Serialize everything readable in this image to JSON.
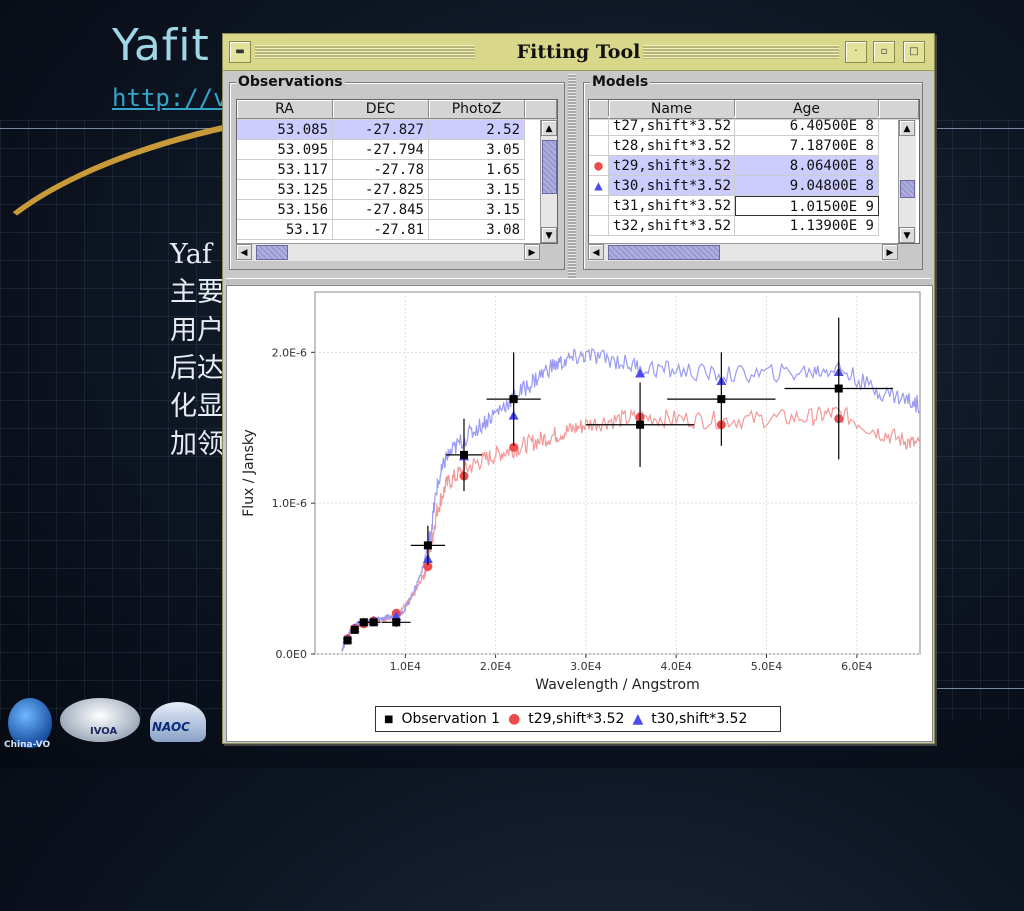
{
  "slide": {
    "title": "Yafit",
    "link": "http://v",
    "body_lines": [
      "Yaf",
      "主要",
      "用户",
      "后达",
      "化显",
      "加领"
    ],
    "logos": {
      "chinavo": "China-VO",
      "ivoa": "IVOA",
      "naoc": "NAOC"
    }
  },
  "window": {
    "title": "Fitting Tool",
    "buttons": [
      "minimize",
      "maximize",
      "close"
    ]
  },
  "observations": {
    "title": "Observations",
    "columns": [
      "RA",
      "DEC",
      "PhotoZ"
    ],
    "rows": [
      {
        "ra": "53.085",
        "dec": "-27.827",
        "z": "2.52",
        "selected": true
      },
      {
        "ra": "53.095",
        "dec": "-27.794",
        "z": "3.05",
        "selected": false
      },
      {
        "ra": "53.117",
        "dec": "-27.78",
        "z": "1.65",
        "selected": false
      },
      {
        "ra": "53.125",
        "dec": "-27.825",
        "z": "3.15",
        "selected": false
      },
      {
        "ra": "53.156",
        "dec": "-27.845",
        "z": "3.15",
        "selected": false
      },
      {
        "ra": "53.17",
        "dec": "-27.81",
        "z": "3.08",
        "selected": false
      }
    ]
  },
  "models": {
    "title": "Models",
    "columns": [
      "Name",
      "Age"
    ],
    "rows": [
      {
        "name": "t27,shift*3.52",
        "age": "6.40500E 8",
        "marker": "",
        "selected": false
      },
      {
        "name": "t28,shift*3.52",
        "age": "7.18700E 8",
        "marker": "",
        "selected": false
      },
      {
        "name": "t29,shift*3.52",
        "age": "8.06400E 8",
        "marker": "circle",
        "selected": true
      },
      {
        "name": "t30,shift*3.52",
        "age": "9.04800E 8",
        "marker": "triangle",
        "selected": true
      },
      {
        "name": "t31,shift*3.52",
        "age": "1.01500E 9",
        "marker": "",
        "selected": false
      },
      {
        "name": "t32,shift*3.52",
        "age": "1.13900E 9",
        "marker": "",
        "selected": false
      }
    ]
  },
  "chart_data": {
    "type": "scatter",
    "xlabel": "Wavelength / Angstrom",
    "ylabel": "Flux / Jansky",
    "xlim": [
      0,
      67000
    ],
    "ylim": [
      0,
      2.4e-06
    ],
    "x_ticks": [
      "1.0E4",
      "2.0E4",
      "3.0E4",
      "4.0E4",
      "5.0E4",
      "6.0E4"
    ],
    "y_ticks": [
      "0.0E0",
      "1.0E-6",
      "2.0E-6"
    ],
    "grid": true,
    "legend_position": "bottom",
    "series": [
      {
        "name": "Observation 1",
        "marker": "square",
        "color": "#000000",
        "points": [
          {
            "x": 3600,
            "y": 9e-08,
            "xerr": 0,
            "yerr": 2e-08
          },
          {
            "x": 4400,
            "y": 1.6e-07,
            "xerr": 400,
            "yerr": 2e-08
          },
          {
            "x": 5400,
            "y": 2.1e-07,
            "xerr": 600,
            "yerr": 2e-08
          },
          {
            "x": 6500,
            "y": 2.1e-07,
            "xerr": 700,
            "yerr": 2e-08
          },
          {
            "x": 9000,
            "y": 2.1e-07,
            "xerr": 1600,
            "yerr": 3e-08
          },
          {
            "x": 12500,
            "y": 7.2e-07,
            "xerr": 1900,
            "yerr": 1.3e-07
          },
          {
            "x": 16500,
            "y": 1.32e-06,
            "xerr": 2000,
            "yerr": 2.4e-07
          },
          {
            "x": 22000,
            "y": 1.69e-06,
            "xerr": 3000,
            "yerr": 3.1e-07
          },
          {
            "x": 36000,
            "y": 1.52e-06,
            "xerr": 6000,
            "yerr": 2.8e-07
          },
          {
            "x": 45000,
            "y": 1.69e-06,
            "xerr": 6000,
            "yerr": 3.1e-07
          },
          {
            "x": 58000,
            "y": 1.76e-06,
            "xerr": 6000,
            "yerr": 4.7e-07
          }
        ]
      },
      {
        "name": "t29,shift*3.52",
        "marker": "circle",
        "color": "#ee4b4b",
        "points": [
          {
            "x": 3600,
            "y": 1e-07
          },
          {
            "x": 4400,
            "y": 1.7e-07
          },
          {
            "x": 5400,
            "y": 2e-07
          },
          {
            "x": 6500,
            "y": 2.2e-07
          },
          {
            "x": 9000,
            "y": 2.7e-07
          },
          {
            "x": 12500,
            "y": 5.8e-07
          },
          {
            "x": 16500,
            "y": 1.18e-06
          },
          {
            "x": 22000,
            "y": 1.37e-06
          },
          {
            "x": 36000,
            "y": 1.57e-06
          },
          {
            "x": 45000,
            "y": 1.52e-06
          },
          {
            "x": 58000,
            "y": 1.56e-06
          }
        ]
      },
      {
        "name": "t30,shift*3.52",
        "marker": "triangle",
        "color": "#4b4bee",
        "points": [
          {
            "x": 3600,
            "y": 1e-07
          },
          {
            "x": 4400,
            "y": 1.7e-07
          },
          {
            "x": 5400,
            "y": 2.1e-07
          },
          {
            "x": 6500,
            "y": 2.2e-07
          },
          {
            "x": 9000,
            "y": 2.5e-07
          },
          {
            "x": 12500,
            "y": 6.3e-07
          },
          {
            "x": 16500,
            "y": 1.31e-06
          },
          {
            "x": 22000,
            "y": 1.58e-06
          },
          {
            "x": 36000,
            "y": 1.86e-06
          },
          {
            "x": 45000,
            "y": 1.81e-06
          },
          {
            "x": 58000,
            "y": 1.87e-06
          }
        ]
      }
    ],
    "spectra": [
      {
        "name": "t29,shift*3.52",
        "color": "#f29a9a",
        "x": [
          3000,
          3500,
          4000,
          4500,
          5000,
          6000,
          7000,
          8000,
          9000,
          10000,
          11000,
          12000,
          12800,
          13500,
          14500,
          16000,
          18000,
          20000,
          22000,
          24000,
          26000,
          28000,
          30000,
          33000,
          36000,
          40000,
          45000,
          50000,
          55000,
          58000,
          62000,
          65000,
          67000
        ],
        "y": [
          3e-08,
          1e-07,
          1.6e-07,
          1.9e-07,
          2e-07,
          2.1e-07,
          2.2e-07,
          2.4e-07,
          2.7e-07,
          3.2e-07,
          4e-07,
          5.2e-07,
          7e-07,
          9.5e-07,
          1.12e-06,
          1.2e-06,
          1.27e-06,
          1.32e-06,
          1.36e-06,
          1.4e-06,
          1.44e-06,
          1.48e-06,
          1.52e-06,
          1.55e-06,
          1.57e-06,
          1.56e-06,
          1.55e-06,
          1.56e-06,
          1.57e-06,
          1.6e-06,
          1.48e-06,
          1.42e-06,
          1.38e-06
        ]
      },
      {
        "name": "t30,shift*3.52",
        "color": "#9a9af2",
        "x": [
          3000,
          3500,
          4000,
          4500,
          5000,
          6000,
          7000,
          8000,
          9000,
          10000,
          11000,
          12000,
          12800,
          13500,
          14500,
          16000,
          18000,
          20000,
          22000,
          24000,
          26000,
          28000,
          30000,
          33000,
          36000,
          40000,
          45000,
          50000,
          55000,
          58000,
          62000,
          65000,
          67000
        ],
        "y": [
          3e-08,
          1e-07,
          1.6e-07,
          1.9e-07,
          2.1e-07,
          2.2e-07,
          2.3e-07,
          2.4e-07,
          2.5e-07,
          3e-07,
          4.2e-07,
          5.8e-07,
          8e-07,
          1.1e-06,
          1.3e-06,
          1.4e-06,
          1.5e-06,
          1.6e-06,
          1.7e-06,
          1.8e-06,
          1.9e-06,
          1.95e-06,
          1.98e-06,
          1.95e-06,
          1.9e-06,
          1.88e-06,
          1.85e-06,
          1.86e-06,
          1.87e-06,
          1.9e-06,
          1.75e-06,
          1.7e-06,
          1.65e-06
        ]
      }
    ]
  },
  "colors": {
    "titlebar": "#d9d88a",
    "selection": "#ccccff",
    "obs_marker": "#000000",
    "model1": "#ee4b4b",
    "model2": "#4b4bee"
  }
}
